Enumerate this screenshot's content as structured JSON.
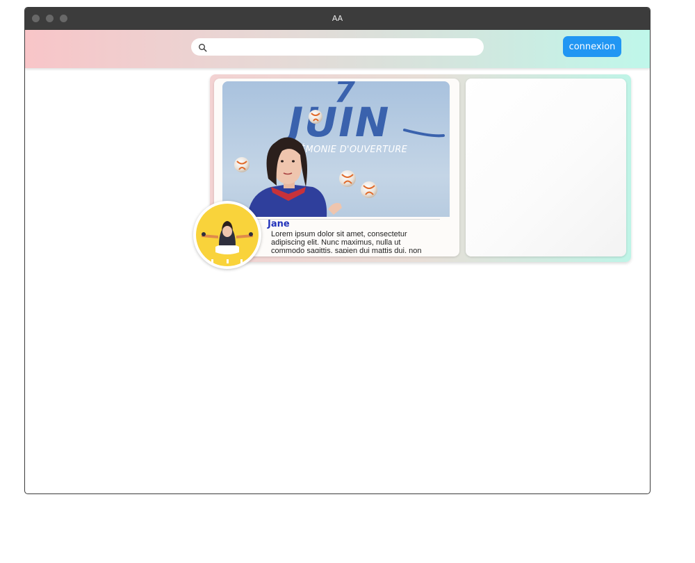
{
  "window": {
    "title": "AA"
  },
  "navbar": {
    "search": {
      "value": "",
      "placeholder": ""
    },
    "connexion_label": "connexion",
    "icons": {
      "search": "search-icon"
    }
  },
  "feed": {
    "posts": [
      {
        "image": {
          "number": "7",
          "headline": "JUIN",
          "subtitle": "CÉRÉMONIE D'OUVERTURE"
        },
        "author": "Jane",
        "text": "Lorem ipsum dolor sit amet, consectetur adipiscing elit. Nunc maximus, nulla ut commodo sagittis, sapien dui mattis dui, non"
      }
    ]
  },
  "colors": {
    "accent": "#2196f3",
    "author_name": "#2233bb",
    "avatar_background": "#f9d33b"
  }
}
